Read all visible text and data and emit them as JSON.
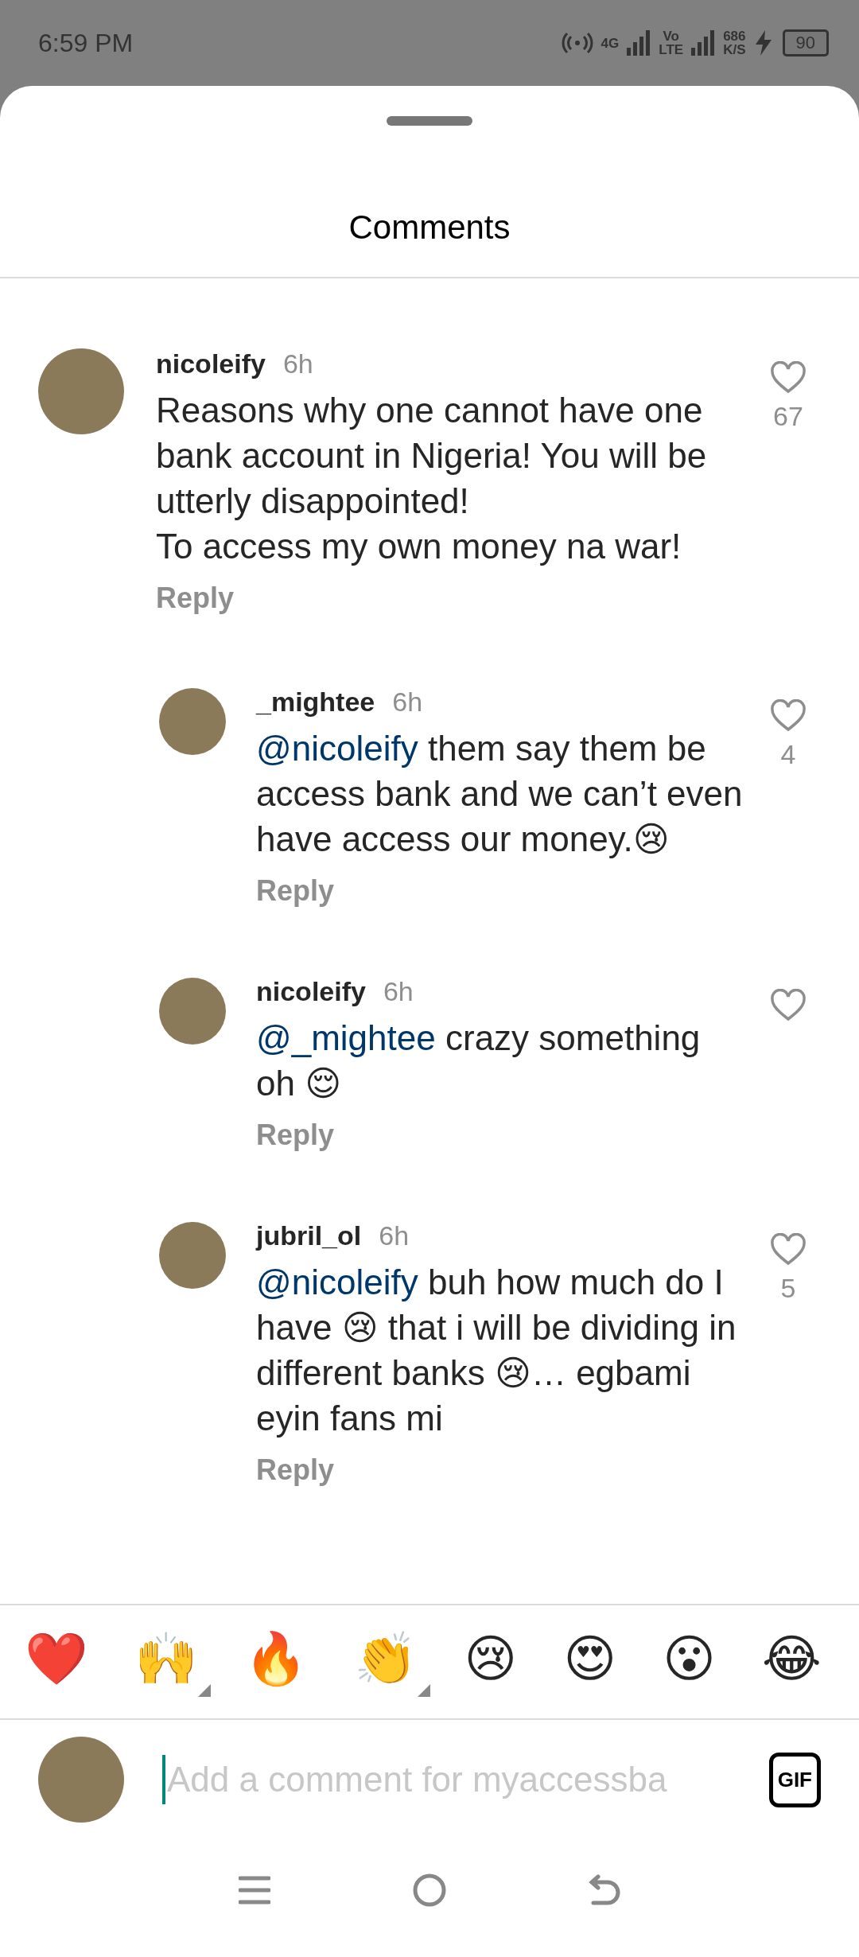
{
  "status_bar": {
    "time": "6:59 PM",
    "network": "4G",
    "volte": [
      "Vo",
      "LTE"
    ],
    "speed": [
      "686",
      "K/S"
    ],
    "battery": "90"
  },
  "sheet": {
    "title": "Comments"
  },
  "comments": [
    {
      "username": "nicoleify",
      "time": "6h",
      "text": "Reasons why one cannot have one bank account in Nigeria! You will be utterly disappointed!\nTo access my own money na war!",
      "likes": "67",
      "liked": false,
      "reply": "Reply",
      "children": [
        {
          "username": "_mightee",
          "time": "6h",
          "mention": "@nicoleify",
          "text": "them say them be access bank and we can’t even have access our money.😢",
          "likes": "4",
          "liked": false,
          "reply": "Reply"
        },
        {
          "username": "nicoleify",
          "time": "6h",
          "mention": "@_mightee",
          "text": "crazy something oh 😌",
          "liked": false,
          "reply": "Reply"
        },
        {
          "username": "jubril_ol",
          "time": "6h",
          "mention": "@nicoleify",
          "text": "buh how much do I have 😢 that i will be dividing in different banks 😢… egbami eyin fans mi",
          "likes": "5",
          "liked": false,
          "reply": "Reply"
        }
      ]
    }
  ],
  "reactions": [
    {
      "emoji": "❤️",
      "variants": false
    },
    {
      "emoji": "🙌",
      "variants": true
    },
    {
      "emoji": "🔥",
      "variants": false
    },
    {
      "emoji": "👏",
      "variants": true
    },
    {
      "emoji": "😢",
      "variants": false
    },
    {
      "emoji": "😍",
      "variants": false
    },
    {
      "emoji": "😮",
      "variants": false
    },
    {
      "emoji": "😂",
      "variants": false
    }
  ],
  "composer": {
    "placeholder": "Add a comment for myaccessba",
    "gif": "GIF"
  }
}
